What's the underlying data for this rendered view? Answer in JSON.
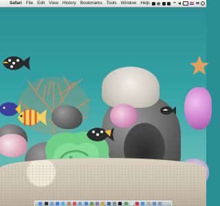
{
  "menubar": {
    "apple_glyph": "",
    "items": [
      "Safari",
      "File",
      "Edit",
      "View",
      "History",
      "Bookmarks",
      "Tools",
      "Window",
      "Help"
    ]
  },
  "status_icons": [
    "display-icon",
    "disk-icon",
    "time-machine-icon",
    "bluetooth-icon",
    "wifi-icon",
    "volume-icon",
    "battery-icon",
    "flag-icon",
    "user-list-icon",
    "spotlight-icon"
  ],
  "scene": {
    "colors": {
      "water_top": "#2c8f97",
      "water_bottom": "#78c2b6",
      "sand": "#d9d0bf"
    }
  },
  "dock": {
    "icons": [
      {
        "name": "finder-icon",
        "color": "#4a8fd8"
      },
      {
        "name": "dashboard-icon",
        "color": "#333333"
      },
      {
        "name": "mail-icon",
        "color": "#7aa0c8"
      },
      {
        "name": "safari-icon",
        "color": "#3a7fd0"
      },
      {
        "name": "ichat-icon",
        "color": "#5bb0e0"
      },
      {
        "name": "address-book-icon",
        "color": "#b08a5a"
      },
      {
        "name": "ical-icon",
        "color": "#e05050"
      },
      {
        "name": "preview-icon",
        "color": "#6aa0c0"
      },
      {
        "name": "itunes-icon",
        "color": "#4a7fd0"
      },
      {
        "name": "iphoto-icon",
        "color": "#6a9a4a"
      },
      {
        "name": "imovie-icon",
        "color": "#8a7aa0"
      },
      {
        "name": "garageband-icon",
        "color": "#d0a040"
      },
      {
        "name": "time-machine-icon",
        "color": "#3a6a9a"
      },
      {
        "name": "system-preferences-icon",
        "color": "#888888"
      },
      {
        "name": "terminal-icon",
        "color": "#222222"
      },
      {
        "name": "activity-monitor-icon",
        "color": "#5a9a5a"
      },
      {
        "name": "textedit-icon",
        "color": "#dddddd"
      },
      {
        "name": "photo-booth-icon",
        "color": "#c04040"
      },
      {
        "name": "app-store-icon",
        "color": "#4a90e0"
      },
      {
        "name": "calculator-icon",
        "color": "#aaaaaa"
      },
      {
        "name": "downloads-stack-icon",
        "color": "#6a8ab0"
      },
      {
        "name": "documents-stack-icon",
        "color": "#7a9ac0"
      },
      {
        "name": "trash-icon",
        "color": "#c8c8c8"
      }
    ]
  }
}
